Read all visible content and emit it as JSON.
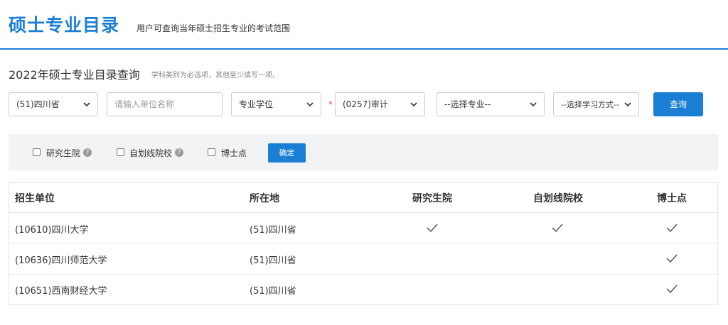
{
  "header": {
    "title": "硕士专业目录",
    "subtitle": "用户可查询当年硕士招生专业的考试范围"
  },
  "query": {
    "title": "2022年硕士专业目录查询",
    "hint": "学科类别为必选项，其他至少填写一项。",
    "province_select": "(51)四川省",
    "unit_placeholder": "请输入单位名称",
    "degree_select": "专业学位",
    "required_mark": "*",
    "subject_select": "(0257)审计",
    "major_select": "--选择专业--",
    "study_mode_select": "--选择学习方式--",
    "query_button": "查询"
  },
  "filters": {
    "grad_school": "研究生院",
    "self_line": "自划线院校",
    "doctoral": "博士点",
    "help_glyph": "?",
    "confirm_button": "确定"
  },
  "table": {
    "headers": [
      "招生单位",
      "所在地",
      "研究生院",
      "自划线院校",
      "博士点"
    ],
    "rows": [
      {
        "unit": "(10610)四川大学",
        "location": "(51)四川省",
        "grad_school": true,
        "self_line": true,
        "doctoral": true
      },
      {
        "unit": "(10636)四川师范大学",
        "location": "(51)四川省",
        "grad_school": false,
        "self_line": false,
        "doctoral": true
      },
      {
        "unit": "(10651)西南财经大学",
        "location": "(51)四川省",
        "grad_school": false,
        "self_line": false,
        "doctoral": true
      }
    ]
  },
  "colors": {
    "accent": "#1a7fd4",
    "panel_bg": "#f2f3f5",
    "required": "#d9534f"
  },
  "icons": {
    "select_arrow": "chevron-down-icon",
    "row_flag": "check-icon",
    "help": "help-icon"
  }
}
